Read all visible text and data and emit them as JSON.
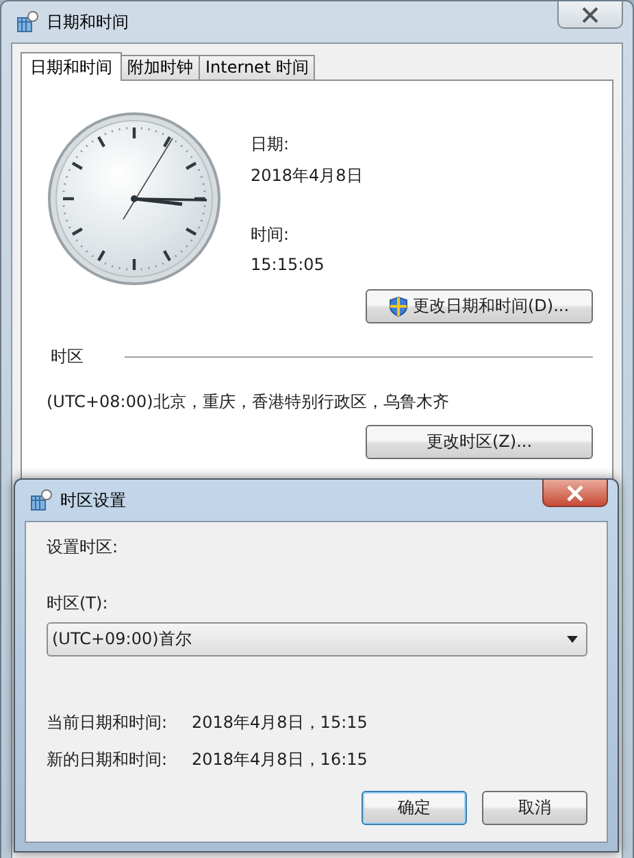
{
  "main_window": {
    "title": "日期和时间",
    "tabs": [
      {
        "label": "日期和时间",
        "selected": true
      },
      {
        "label": "附加时钟",
        "selected": false
      },
      {
        "label": "Internet 时间",
        "selected": false
      }
    ],
    "date_label": "日期:",
    "date": "2018年4月8日",
    "time_label": "时间:",
    "time": "15:15:05",
    "change_datetime_button": "更改日期和时间(D)...",
    "timezone_heading": "时区",
    "timezone": "(UTC+08:00)北京，重庆，香港特别行政区，乌鲁木齐",
    "change_timezone_button": "更改时区(Z)..."
  },
  "dialog": {
    "title": "时区设置",
    "prompt": "设置时区:",
    "timezone_label": "时区(T):",
    "timezone_value": "(UTC+09:00)首尔",
    "rows": [
      {
        "label": "当前日期和时间:",
        "value": "2018年4月8日，15:15"
      },
      {
        "label": "新的日期和时间:",
        "value": "2018年4月8日，16:15"
      }
    ],
    "buttons": [
      {
        "label": "确定",
        "default": true
      },
      {
        "label": "取消",
        "default": false
      }
    ]
  }
}
